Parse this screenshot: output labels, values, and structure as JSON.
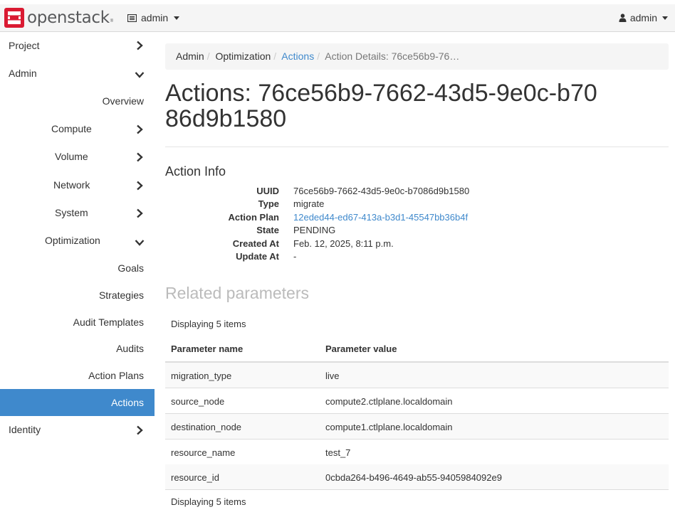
{
  "header": {
    "logo_text": "openstack",
    "logo_tm": "®",
    "project_menu": "admin",
    "user_menu": "admin"
  },
  "sidebar": {
    "items": [
      {
        "label": "Project",
        "icon": "chevron-right-icon"
      },
      {
        "label": "Admin",
        "icon": "chevron-down-icon"
      },
      {
        "label": "Overview"
      },
      {
        "label": "Compute",
        "icon": "chevron-right-icon"
      },
      {
        "label": "Volume",
        "icon": "chevron-right-icon"
      },
      {
        "label": "Network",
        "icon": "chevron-right-icon"
      },
      {
        "label": "System",
        "icon": "chevron-right-icon"
      },
      {
        "label": "Optimization",
        "icon": "chevron-down-icon"
      },
      {
        "label": "Goals"
      },
      {
        "label": "Strategies"
      },
      {
        "label": "Audit Templates"
      },
      {
        "label": "Audits"
      },
      {
        "label": "Action Plans"
      },
      {
        "label": "Actions"
      },
      {
        "label": "Identity",
        "icon": "chevron-right-icon"
      }
    ],
    "active_color": "#3f89cc"
  },
  "breadcrumb": {
    "items": [
      "Admin",
      "Optimization",
      "Actions",
      "Action Details: 76ce56b9-76…"
    ]
  },
  "page_title": "Actions: 76ce56b9-7662-43d5-9e0c-b7086d9b1580",
  "action_info": {
    "heading": "Action Info",
    "fields": [
      {
        "label": "UUID",
        "value": "76ce56b9-7662-43d5-9e0c-b7086d9b1580"
      },
      {
        "label": "Type",
        "value": "migrate"
      },
      {
        "label": "Action Plan",
        "value": "12eded44-ed67-413a-b3d1-45547bb36b4f"
      },
      {
        "label": "State",
        "value": "PENDING"
      },
      {
        "label": "Created At",
        "value": "Feb. 12, 2025, 8:11 p.m."
      },
      {
        "label": "Update At",
        "value": "-"
      }
    ]
  },
  "related": {
    "heading": "Related parameters",
    "count_text_top": "Displaying 5 items",
    "count_text_bottom": "Displaying 5 items",
    "columns": [
      "Parameter name",
      "Parameter value"
    ],
    "rows": [
      [
        "migration_type",
        "live"
      ],
      [
        "source_node",
        "compute2.ctlplane.localdomain"
      ],
      [
        "destination_node",
        "compute1.ctlplane.localdomain"
      ],
      [
        "resource_name",
        "test_7"
      ],
      [
        "resource_id",
        "0cbda264-b496-4649-ab55-9405984092e9"
      ]
    ]
  }
}
